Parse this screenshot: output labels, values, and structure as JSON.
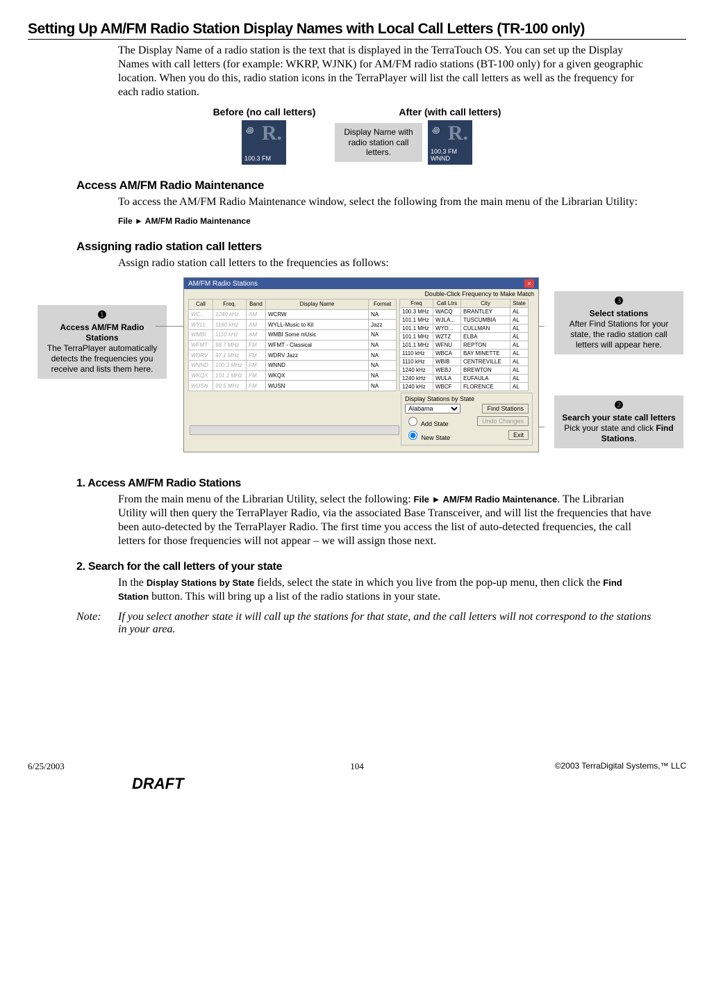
{
  "title": "Setting Up AM/FM Radio Station Display Names with Local Call Letters (TR-100 only)",
  "intro": "The Display Name of a radio station is the text that is displayed in the TerraTouch OS. You can set up the Display Names with call letters (for example: WKRP, WJNK) for AM/FM radio stations (BT-100 only) for a given geographic location.  When you do this, radio station icons in the TerraPlayer will list the call letters as well as the frequency for each radio station.",
  "compare": {
    "before_label": "Before (no call letters)",
    "after_label": "After (with call letters)",
    "before_freq": "100.3 FM",
    "after_freq": "100.3 FM",
    "after_call": "WNND",
    "callout": "Display Name with radio station call letters."
  },
  "sections": {
    "access_h": "Access AM/FM Radio Maintenance",
    "access_p": "To access the AM/FM Radio Maintenance window, select the following from the main menu of the Librarian Utility:",
    "access_path": "File ► AM/FM Radio Maintenance",
    "assign_h": "Assigning radio station call letters",
    "assign_p": "Assign radio station call letters to the frequencies as follows:",
    "step1_h": "1.  Access AM/FM Radio Stations",
    "step1_p_a": "From the main menu of the Librarian Utility, select the following: ",
    "step1_path": "File ► AM/FM Radio Maintenance",
    "step1_p_b": ".  The Librarian Utility will then query the TerraPlayer Radio, via the associated Base Transceiver, and will list the frequencies that have been auto-detected by the TerraPlayer Radio.  The first time you access the list of auto-detected frequencies, the call letters for those frequencies will not appear – we will assign those next.",
    "step2_h": "2.  Search for the call letters of your state",
    "step2_p_a": "In the ",
    "step2_field1": "Display Stations by State",
    "step2_p_b": " fields, select the state in which you live from the pop-up menu, then click the ",
    "step2_field2": "Find Station",
    "step2_p_c": " button.  This will bring up a list of the radio stations in your state.",
    "note_label": "Note:",
    "note_text": "If you select another state it will call up the stations for that state, and the call letters will not correspond to the stations in your area."
  },
  "window": {
    "title": "AM/FM Radio Stations",
    "hint": "Double-Click Frequency to Make Match",
    "left_headers": [
      "Call",
      "Freq.",
      "Band",
      "Display Name",
      "Format"
    ],
    "left_rows": [
      [
        "WC...",
        "1240 kHz",
        "AM",
        "WCRW",
        "NA"
      ],
      [
        "WYLL",
        "1160 kHz",
        "AM",
        "WYLL-Music to Kil",
        "Jazz"
      ],
      [
        "WMBI",
        "1110 kHz",
        "AM",
        "WMBI Some mUsic",
        "NA"
      ],
      [
        "WFMT",
        "98.7 MHz",
        "FM",
        "WFMT - Classical",
        "NA"
      ],
      [
        "WDRV",
        "97.1 MHz",
        "FM",
        "WDRV Jazz",
        "NA"
      ],
      [
        "WNND",
        "100.3 MHz",
        "FM",
        "WNND",
        "NA"
      ],
      [
        "WKQX",
        "101.1 MHz",
        "FM",
        "WKQX",
        "NA"
      ],
      [
        "WUSN",
        "99.5 MHz",
        "FM",
        "WUSN",
        "NA"
      ]
    ],
    "right_headers": [
      "Freq",
      "Call Ltrs",
      "City",
      "State"
    ],
    "right_rows": [
      [
        "100.3 MHz",
        "WACQ",
        "BRANTLEY",
        "AL"
      ],
      [
        "101.1 MHz",
        "WJLA...",
        "TUSCUMBIA",
        "AL"
      ],
      [
        "101.1 MHz",
        "WYD...",
        "CULLMAN",
        "AL"
      ],
      [
        "101.1 MHz",
        "WZTZ",
        "ELBA",
        "AL"
      ],
      [
        "101.1 MHz",
        "WFNU",
        "REPTON",
        "AL"
      ],
      [
        "1110 kHz",
        "WBCA",
        "BAY MINETTE",
        "AL"
      ],
      [
        "1110 kHz",
        "WBIB",
        "CENTREVILLE",
        "AL"
      ],
      [
        "1240 kHz",
        "WEBJ",
        "BREWTON",
        "AL"
      ],
      [
        "1240 kHz",
        "WULA",
        "EUFAULA",
        "AL"
      ],
      [
        "1240 kHz",
        "WBCF",
        "FLORENCE",
        "AL"
      ]
    ],
    "display_by_state": "Display Stations by State",
    "state_selected": "Alabama",
    "find_stations": "Find Stations",
    "add_state": "Add State",
    "new_state": "New State",
    "undo": "Undo Changes",
    "exit": "Exit"
  },
  "callouts": {
    "left_num": "❶",
    "left_title": "Access AM/FM Radio Stations",
    "left_text": "The TerraPlayer automatically detects the frequencies you receive and lists them here.",
    "rt_num": "❸",
    "rt_title": "Select stations",
    "rt_text": "After Find Stations for your state, the radio station call letters will appear here.",
    "rb_num": "❷",
    "rb_title": "Search your state call letters",
    "rb_text_a": "Pick your state and click ",
    "rb_text_b": "Find Stations",
    "rb_text_c": "."
  },
  "footer": {
    "date": "6/25/2003",
    "copy": "©2003 TerraDigital Systems,™ LLC",
    "page": "104",
    "draft": "DRAFT"
  }
}
